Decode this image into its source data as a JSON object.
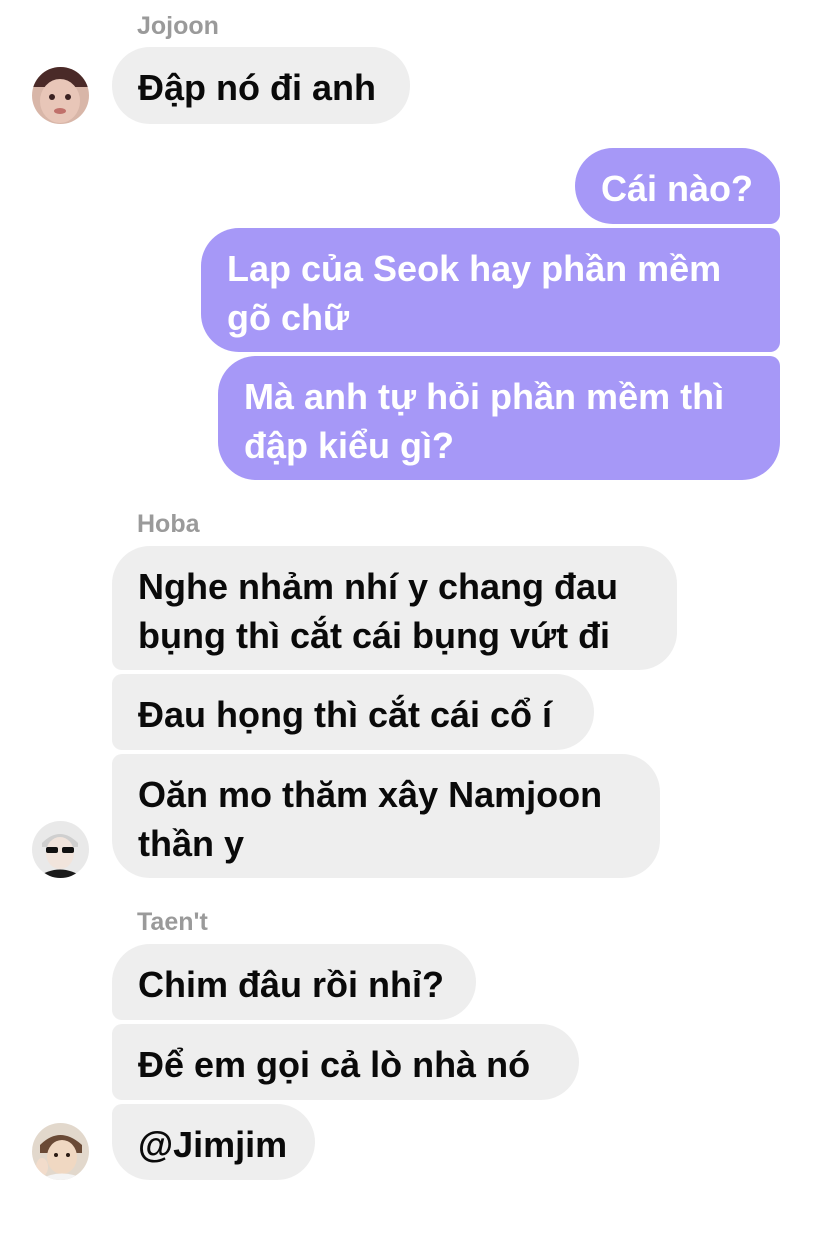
{
  "chat": {
    "colors": {
      "incoming_bubble": "#eeeeee",
      "outgoing_bubble": "#a698f7",
      "sender_name": "#9a9a9a"
    },
    "groups": [
      {
        "sender": "Jojoon",
        "avatar": "jojoon-avatar",
        "messages": [
          "Đập nó đi anh"
        ]
      },
      {
        "sender": "me",
        "outgoing": true,
        "messages": [
          "Cái nào?",
          "Lap của Seok hay phần mềm gõ chữ",
          "Mà anh tự hỏi phần mềm thì đập kiểu gì?"
        ]
      },
      {
        "sender": "Hoba",
        "avatar": "hoba-avatar",
        "messages": [
          "Nghe nhảm nhí y chang đau bụng thì cắt cái bụng vứt đi",
          "Đau họng thì cắt cái cổ í",
          "Oăn mo thăm xây Namjoon thần y"
        ]
      },
      {
        "sender": "Taen't",
        "avatar": "taent-avatar",
        "messages": [
          "Chim đâu rồi nhỉ?",
          "Để em gọi cả lò nhà nó",
          "@Jimjim"
        ]
      }
    ]
  }
}
